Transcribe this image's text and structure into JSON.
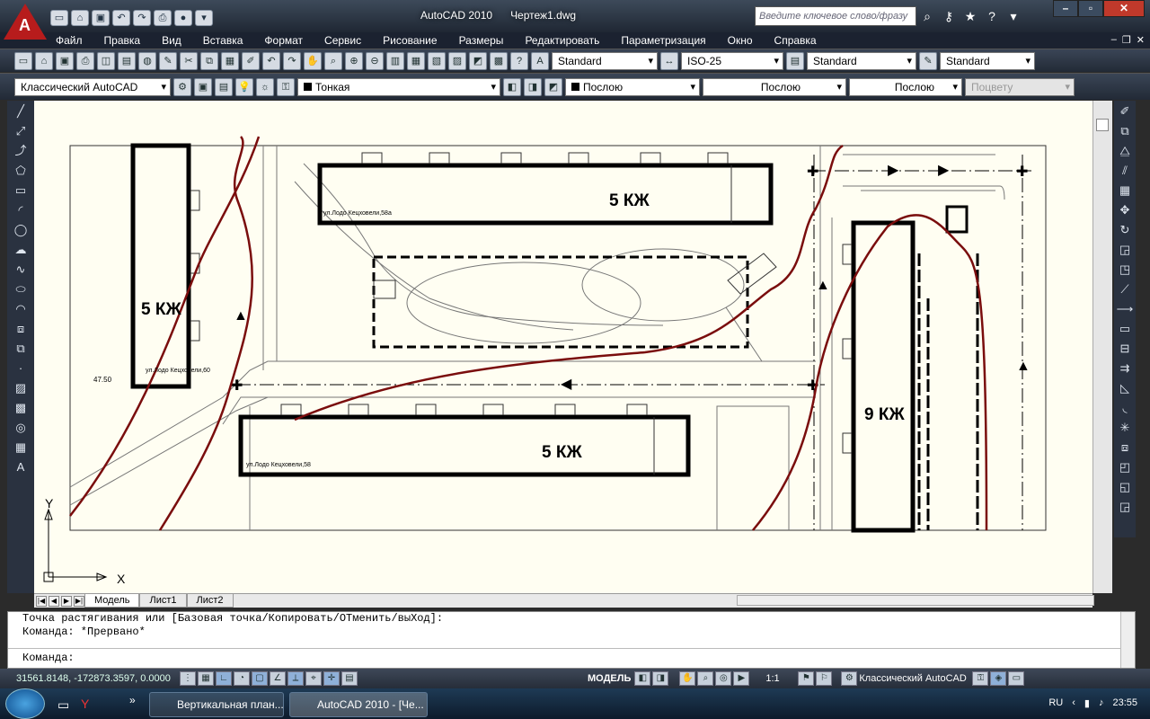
{
  "window": {
    "title": "AutoCAD 2010",
    "file": "Чертеж1.dwg",
    "search_placeholder": "Введите ключевое слово/фразу"
  },
  "menu": [
    "Файл",
    "Правка",
    "Вид",
    "Вставка",
    "Формат",
    "Сервис",
    "Рисование",
    "Размеры",
    "Редактировать",
    "Параметризация",
    "Окно",
    "Справка"
  ],
  "styles": {
    "text": "Standard",
    "dim": "ISO-25",
    "table": "Standard",
    "multileader": "Standard"
  },
  "workspace": "Классический AutoCAD",
  "layer": "Тонкая",
  "props": {
    "color": "Послою",
    "linetype": "Послою",
    "lineweight": "Послою",
    "plotstyle": "Поцвету"
  },
  "drawing": {
    "b1": "5 КЖ",
    "b2": "5 КЖ",
    "b3": "5 КЖ",
    "b4": "9 КЖ",
    "addr1": "ул.Лодо Кецховели,58а",
    "addr2": "ул.Лодо Кецховели,60",
    "addr3": "ул.Лодо Кецховели,58",
    "elev": "47.50",
    "axis_x": "X",
    "axis_y": "Y"
  },
  "tabs": [
    "Модель",
    "Лист1",
    "Лист2"
  ],
  "command": {
    "line1": "Точка растягивания или [Базовая точка/Копировать/ОТменить/выХод]:",
    "line2": "Команда: *Прервано*",
    "prompt": "Команда:"
  },
  "status": {
    "coords": "31561.8148, -172873.3597, 0.0000",
    "mode": "МОДЕЛЬ",
    "scale": "1:1",
    "workspace": "Классический AutoCAD"
  },
  "taskbar": {
    "items": [
      "Вертикальная план...",
      "AutoCAD 2010 - [Че..."
    ],
    "lang": "RU",
    "time": "23:55"
  },
  "colors": {
    "canvas": "#fffef2",
    "road_line": "#7a0d0d",
    "accent": "#b71c1c"
  }
}
